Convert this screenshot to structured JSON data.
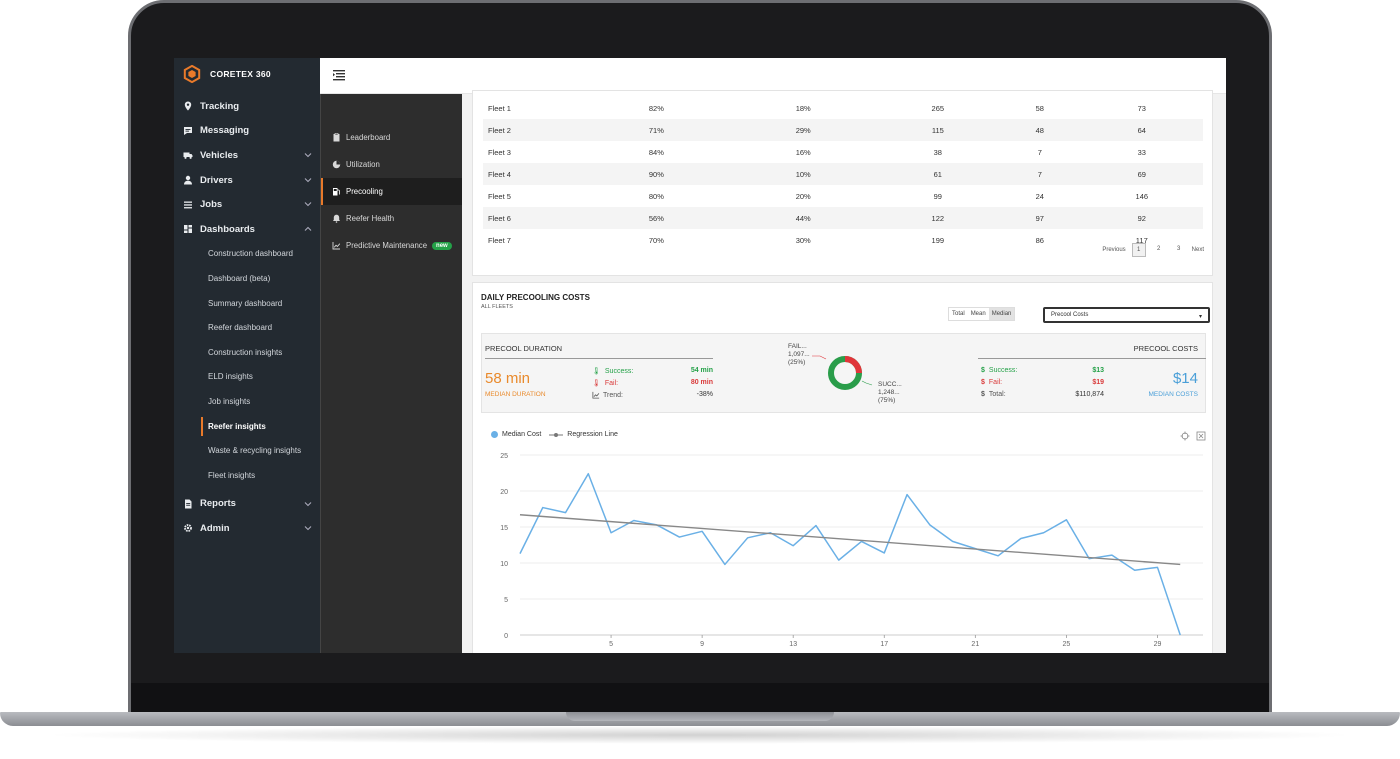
{
  "app": {
    "name": "CORETEX 360",
    "accent": "#e97a2a"
  },
  "sidebar": {
    "items": [
      {
        "label": "Tracking",
        "icon": "map-pin-icon"
      },
      {
        "label": "Messaging",
        "icon": "message-icon"
      },
      {
        "label": "Vehicles",
        "icon": "truck-icon",
        "expandable": true
      },
      {
        "label": "Drivers",
        "icon": "person-icon",
        "expandable": true
      },
      {
        "label": "Jobs",
        "icon": "list-icon",
        "expandable": true
      },
      {
        "label": "Dashboards",
        "icon": "dashboard-icon",
        "expandable": true,
        "expanded": true
      }
    ],
    "dashboards": [
      "Construction dashboard",
      "Dashboard (beta)",
      "Summary dashboard",
      "Reefer dashboard",
      "Construction insights",
      "ELD insights",
      "Job insights",
      "Reefer insights",
      "Waste & recycling insights",
      "Fleet insights"
    ],
    "active_dashboard": "Reefer insights",
    "bottom_items": [
      {
        "label": "Reports",
        "icon": "report-icon"
      },
      {
        "label": "Admin",
        "icon": "gear-icon"
      }
    ]
  },
  "subpanel": {
    "items": [
      {
        "label": "Leaderboard",
        "icon": "clipboard-icon"
      },
      {
        "label": "Utilization",
        "icon": "pie-icon"
      },
      {
        "label": "Precooling",
        "icon": "fuel-icon",
        "active": true
      },
      {
        "label": "Reefer Health",
        "icon": "bell-icon"
      },
      {
        "label": "Predictive Maintenance",
        "icon": "trend-icon",
        "badge": "new"
      }
    ]
  },
  "fleet_table": {
    "rows": [
      [
        "Fleet 1",
        "82%",
        "18%",
        "265",
        "58",
        "73"
      ],
      [
        "Fleet 2",
        "71%",
        "29%",
        "115",
        "48",
        "64"
      ],
      [
        "Fleet 3",
        "84%",
        "16%",
        "38",
        "7",
        "33"
      ],
      [
        "Fleet 4",
        "90%",
        "10%",
        "61",
        "7",
        "69"
      ],
      [
        "Fleet 5",
        "80%",
        "20%",
        "99",
        "24",
        "146"
      ],
      [
        "Fleet 6",
        "56%",
        "44%",
        "122",
        "97",
        "92"
      ],
      [
        "Fleet 7",
        "70%",
        "30%",
        "199",
        "86",
        "117"
      ]
    ],
    "pagination": {
      "previous": "Previous",
      "pages": [
        "1",
        "2",
        "3"
      ],
      "current": "1",
      "next": "Next"
    }
  },
  "precooling": {
    "title": "DAILY PRECOOLING COSTS",
    "subtitle": "ALL FLEETS",
    "toggle": [
      "Total",
      "Mean",
      "Median"
    ],
    "toggle_active": "Median",
    "select_value": "Precool Costs",
    "duration": {
      "label": "PRECOOL DURATION",
      "value": "58 min",
      "caption": "MEDIAN DURATION",
      "success_label": "Success:",
      "success_value": "54 min",
      "fail_label": "Fail:",
      "fail_value": "80 min",
      "trend_label": "Trend:",
      "trend_value": "-38%"
    },
    "donut": {
      "fail_label": "FAIL...",
      "fail_count": "1,097...",
      "fail_pct": "(25%)",
      "success_label": "SUCC...",
      "success_count": "1,248...",
      "success_pct": "(75%)",
      "fail_share": 0.25,
      "success_share": 0.75,
      "fail_color": "#e0353a",
      "success_color": "#2a9d4a"
    },
    "costs": {
      "label": "PRECOOL COSTS",
      "value": "$14",
      "caption": "MEDIAN COSTS",
      "success_label": "Success:",
      "success_value": "$13",
      "fail_label": "Fail:",
      "fail_value": "$19",
      "total_label": "Total:",
      "total_value": "$110,874"
    },
    "colors": {
      "orange": "#e98a2c",
      "blue": "#4a9fd8",
      "green": "#24a148",
      "red": "#d93a3a"
    }
  },
  "chart_data": {
    "type": "line",
    "legend": [
      "Median Cost",
      "Regression Line"
    ],
    "x": [
      1,
      2,
      3,
      4,
      5,
      6,
      7,
      8,
      9,
      10,
      11,
      12,
      13,
      14,
      15,
      16,
      17,
      18,
      19,
      20,
      21,
      22,
      23,
      24,
      25,
      26,
      27,
      28,
      29,
      30,
      31
    ],
    "x_ticks": [
      5,
      9,
      13,
      17,
      21,
      25,
      29
    ],
    "y_ticks": [
      0,
      5,
      10,
      15,
      20,
      25
    ],
    "ylim": [
      0,
      25
    ],
    "xlim": [
      1,
      31
    ],
    "series": [
      {
        "name": "Median Cost",
        "color": "#6ab0e6",
        "values": [
          11.3,
          17.7,
          17.0,
          22.4,
          14.2,
          15.9,
          15.3,
          13.6,
          14.4,
          9.8,
          13.5,
          14.2,
          12.4,
          15.2,
          10.4,
          13.0,
          11.4,
          19.5,
          15.3,
          13.0,
          12.0,
          11.0,
          13.4,
          14.2,
          16.0,
          10.6,
          11.1,
          9.0,
          9.4,
          0
        ]
      }
    ],
    "regression": {
      "name": "Regression Line",
      "color": "#888888",
      "start": 16.7,
      "end": 9.8
    },
    "grid": true,
    "legend_position": "top-left"
  }
}
